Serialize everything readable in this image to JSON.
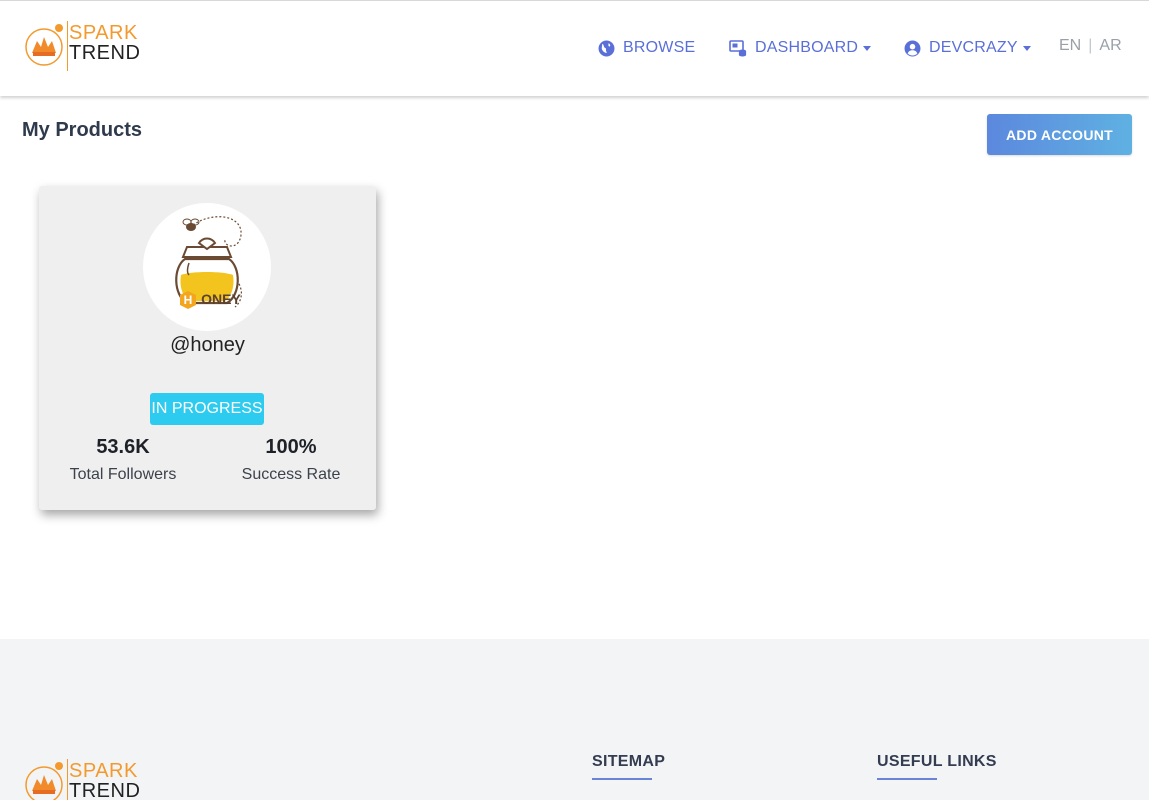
{
  "brand": {
    "line1": "SPARK",
    "line2": "TREND"
  },
  "nav": {
    "browse": "BROWSE",
    "dashboard": "DASHBOARD",
    "user": "DEVCRAZY",
    "lang_en": "EN",
    "lang_sep": "|",
    "lang_ar": "AR"
  },
  "page": {
    "title": "My Products",
    "add_button": "ADD ACCOUNT"
  },
  "products": [
    {
      "logo_word": "HONEY",
      "handle": "@honey",
      "status": "IN PROGRESS",
      "followers_value": "53.6K",
      "followers_label": "Total Followers",
      "success_value": "100%",
      "success_label": "Success Rate"
    }
  ],
  "footer": {
    "sitemap": "SITEMAP",
    "useful_links": "USEFUL LINKS"
  },
  "colors": {
    "accent": "#5a6fd8",
    "brand_orange": "#f39a2e",
    "badge": "#2ccbef",
    "footer_bg": "#f3f4f6"
  },
  "icons": [
    "globe-icon",
    "dashboard-icon",
    "user-circle-icon",
    "caret-down-icon"
  ]
}
